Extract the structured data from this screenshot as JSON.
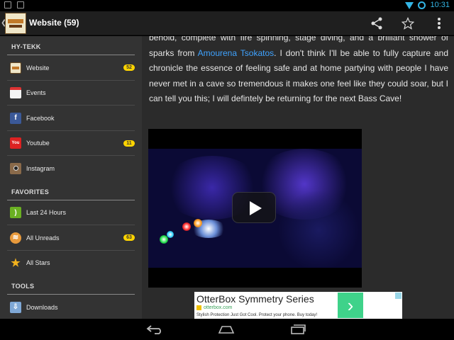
{
  "status_bar": {
    "time": "10:31"
  },
  "app": {
    "title": "Website (59)"
  },
  "sidebar": {
    "sections": [
      {
        "header": "HY-TEKK",
        "items": [
          {
            "label": "Website",
            "icon": "website-logo-icon",
            "badge": "52"
          },
          {
            "label": "Events",
            "icon": "calendar-icon",
            "badge": ""
          },
          {
            "label": "Facebook",
            "icon": "facebook-icon",
            "badge": ""
          },
          {
            "label": "Youtube",
            "icon": "youtube-icon",
            "badge": "11"
          },
          {
            "label": "Instagram",
            "icon": "instagram-icon",
            "badge": ""
          }
        ]
      },
      {
        "header": "FAVORITES",
        "items": [
          {
            "label": "Last 24 Hours",
            "icon": "rss-icon",
            "badge": ""
          },
          {
            "label": "All Unreads",
            "icon": "unreads-icon",
            "badge": "63"
          },
          {
            "label": "All Stars",
            "icon": "star-icon",
            "badge": ""
          }
        ]
      },
      {
        "header": "TOOLS",
        "items": [
          {
            "label": "Downloads",
            "icon": "downloads-icon",
            "badge": ""
          }
        ]
      }
    ]
  },
  "article": {
    "text_before_link": "behold, complete with fire spinning, stage diving, and a brilliant shower of sparks from ",
    "link_text": "Amourena Tsokatos",
    "text_after_link": ". I don't think I'll be able to fully capture and chronicle the essence of feeling safe and at home partying with people I have never met in a cave so tremendous it makes one feel like they could soar, but I can tell you this; I will defintely be returning for the next Bass Cave!"
  },
  "ad": {
    "title": "OtterBox Symmetry Series",
    "url": "otterbox.com",
    "description": "Stylish Protection Just Got Cool. Protect your phone. Buy today!"
  },
  "colors": {
    "accent": "#33b5e5",
    "badge": "#ffd400",
    "link": "#3fa3ff",
    "sidebar_bg": "#333333",
    "content_bg": "#2b2b2b"
  }
}
